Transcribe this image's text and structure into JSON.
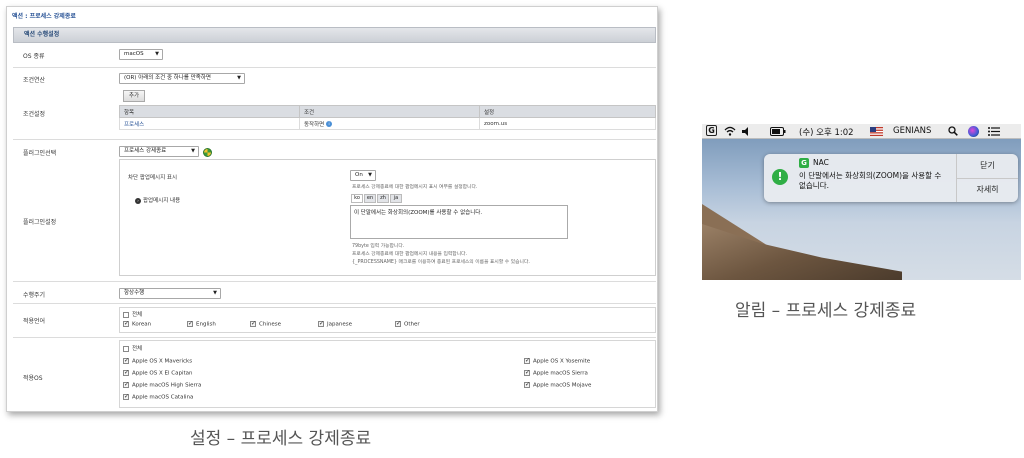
{
  "settings": {
    "breadcrumb": "액션 : 프로세스 강제종료",
    "section_title": "액션 수행설정",
    "os_type": {
      "label": "OS 종류",
      "value": "macOS"
    },
    "condition_op": {
      "label": "조건연산",
      "value": "(OR) 아래의 조건 중 하나를 만족하면"
    },
    "condition": {
      "label": "조건설정",
      "add_label": "추가",
      "headers": [
        "항목",
        "조건",
        "설정"
      ],
      "row": {
        "item": "프로세스",
        "cond": "동작하면",
        "value": "zoom.us"
      }
    },
    "plugin_select": {
      "label": "플러그인선택",
      "value": "프로세스 강제종료"
    },
    "plugin_settings": {
      "label": "플러그인설정",
      "popup_label": "차단 팝업메시지 표시",
      "popup_value": "On",
      "popup_help": "프로세스 강제종료에 대한 팝업메시지 표시 여부를 설정합니다.",
      "content_label": "팝업메시지 내용",
      "langs": [
        "ko",
        "en",
        "zh",
        "ja"
      ],
      "message": "이 단말에서는 화상회의(ZOOM)를 사용할 수 없습니다.",
      "note1": "79byte 입력 가능합니다.",
      "note2": "프로세스 강제종료에 대한 팝업메시지 내용을 입력합니다.",
      "note3": "{_PROCESSNAME} 매크로를 이용하여 종료된 프로세스의 이름을 표시할 수 있습니다."
    },
    "cycle": {
      "label": "수행주기",
      "value": "항상수행"
    },
    "languages": {
      "label": "적용언어",
      "all": "전체",
      "items": [
        "Korean",
        "English",
        "Chinese",
        "Japanese",
        "Other"
      ]
    },
    "os": {
      "label": "적용OS",
      "all": "전체",
      "left": [
        "Apple OS X Mavericks",
        "Apple OS X El Capitan",
        "Apple macOS High Sierra",
        "Apple macOS Catalina"
      ],
      "right": [
        "Apple OS X Yosemite",
        "Apple macOS Sierra",
        "Apple macOS Mojave"
      ]
    },
    "caption": "설정 – 프로세스 강제종료"
  },
  "mac": {
    "menubar": {
      "g_icon": "G",
      "clock": "(수) 오후 1:02",
      "user": "GENIANS"
    },
    "notification": {
      "app_icon": "G",
      "app": "NAC",
      "message": "이 단말에서는 화상회의(ZOOM)을 사용할 수 없습니다.",
      "close": "닫기",
      "details": "자세히"
    },
    "caption": "알림 – 프로세스 강제종료"
  },
  "colors": {
    "accent": "#2b5597",
    "header": "#ccd0d6",
    "success": "#2fae45"
  },
  "icons": [
    "wifi-icon",
    "volume-icon",
    "battery-icon",
    "flag-icon",
    "search-icon",
    "siri-icon",
    "list-icon",
    "warning-icon",
    "info-icon",
    "plugin-icon"
  ]
}
